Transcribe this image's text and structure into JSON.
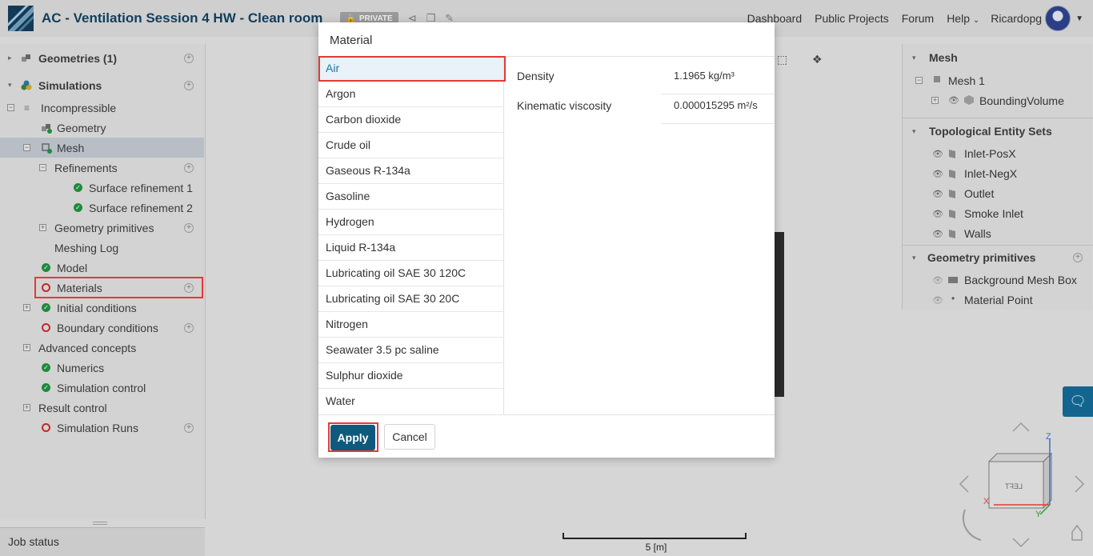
{
  "app": {
    "project_title": "AC - Ventilation Session 4 HW - Clean room",
    "private_label": "PRIVATE"
  },
  "nav": {
    "items": [
      "Dashboard",
      "Public Projects",
      "Forum",
      "Help",
      "Ricardopg"
    ]
  },
  "left_tree": {
    "geometries": "Geometries (1)",
    "simulations": "Simulations",
    "incompressible": "Incompressible",
    "geometry": "Geometry",
    "mesh": "Mesh",
    "refinements": "Refinements",
    "surface_refinement_1": "Surface refinement 1",
    "surface_refinement_2": "Surface refinement 2",
    "geometry_primitives": "Geometry primitives",
    "meshing_log": "Meshing Log",
    "model": "Model",
    "materials": "Materials",
    "initial_conditions": "Initial conditions",
    "boundary_conditions": "Boundary conditions",
    "advanced_concepts": "Advanced concepts",
    "numerics": "Numerics",
    "simulation_control": "Simulation control",
    "result_control": "Result control",
    "simulation_runs": "Simulation Runs"
  },
  "job_status": "Job status",
  "right_panel": {
    "mesh_title": "Mesh",
    "mesh_1": "Mesh 1",
    "bounding_volume": "BoundingVolume",
    "topo_title": "Topological Entity Sets",
    "topo_items": [
      "Inlet-PosX",
      "Inlet-NegX",
      "Outlet",
      "Smoke Inlet",
      "Walls"
    ],
    "prim_title": "Geometry primitives",
    "prim_items": [
      "Background Mesh Box",
      "Material Point"
    ]
  },
  "viewer": {
    "scale_label": "5 [m]",
    "cube_face": "LEFT",
    "axis_z": "Z",
    "axis_x": "X",
    "axis_y": "Y"
  },
  "modal": {
    "title": "Material",
    "materials": [
      "Air",
      "Argon",
      "Carbon dioxide",
      "Crude oil",
      "Gaseous R-134a",
      "Gasoline",
      "Hydrogen",
      "Liquid R-134a",
      "Lubricating oil SAE 30 120C",
      "Lubricating oil SAE 30 20C",
      "Nitrogen",
      "Seawater 3.5 pc saline",
      "Sulphur dioxide",
      "Water"
    ],
    "selected_material": "Air",
    "properties": [
      {
        "name": "Density",
        "value": "1.1965 kg/m³"
      },
      {
        "name": "Kinematic viscosity",
        "value": "0.000015295 m²/s"
      }
    ],
    "apply_label": "Apply",
    "cancel_label": "Cancel"
  },
  "colors": {
    "accent": "#0f5a7c",
    "ok_green": "#1f8a3b",
    "error_red": "#c62828",
    "highlight_red": "#e53935"
  }
}
